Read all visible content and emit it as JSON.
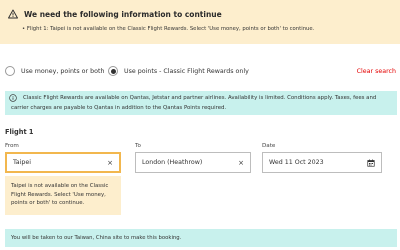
{
  "warning": {
    "title": "We need the following information to continue",
    "items": [
      "Flight 1: Taipei is not available on the Classic Flight Rewards. Select 'Use money, points or both' to continue."
    ],
    "icon": "warning-icon",
    "color": "#fdeecd"
  },
  "fare_options": {
    "option_money": "Use money, points or both",
    "option_points": "Use points - Classic Flight Rewards only",
    "selected": "option_points",
    "clear_label": "Clear search",
    "clear_color": "#e40000"
  },
  "info": {
    "text": "Classic Flight Rewards are available on Qantas, Jetstar and partner airlines. Availability is limited. Conditions apply. Taxes, fees and carrier charges are payable to Qantas in addition to the Qantas Points required.",
    "icon": "info-icon",
    "color": "#c8f1ed"
  },
  "flight": {
    "label": "Flight 1",
    "from_label": "From",
    "from_value": "Taipei",
    "to_label": "To",
    "to_value": "London (Heathrow)",
    "date_label": "Date",
    "date_value": "Wed 11 Oct 2023",
    "clear_icon": "×",
    "from_error": "Taipei is not available on the Classic Flight Rewards. Select 'Use money, points or both' to continue."
  },
  "redirect": {
    "text": "You will be taken to our Taiwan, China site to make this booking."
  }
}
